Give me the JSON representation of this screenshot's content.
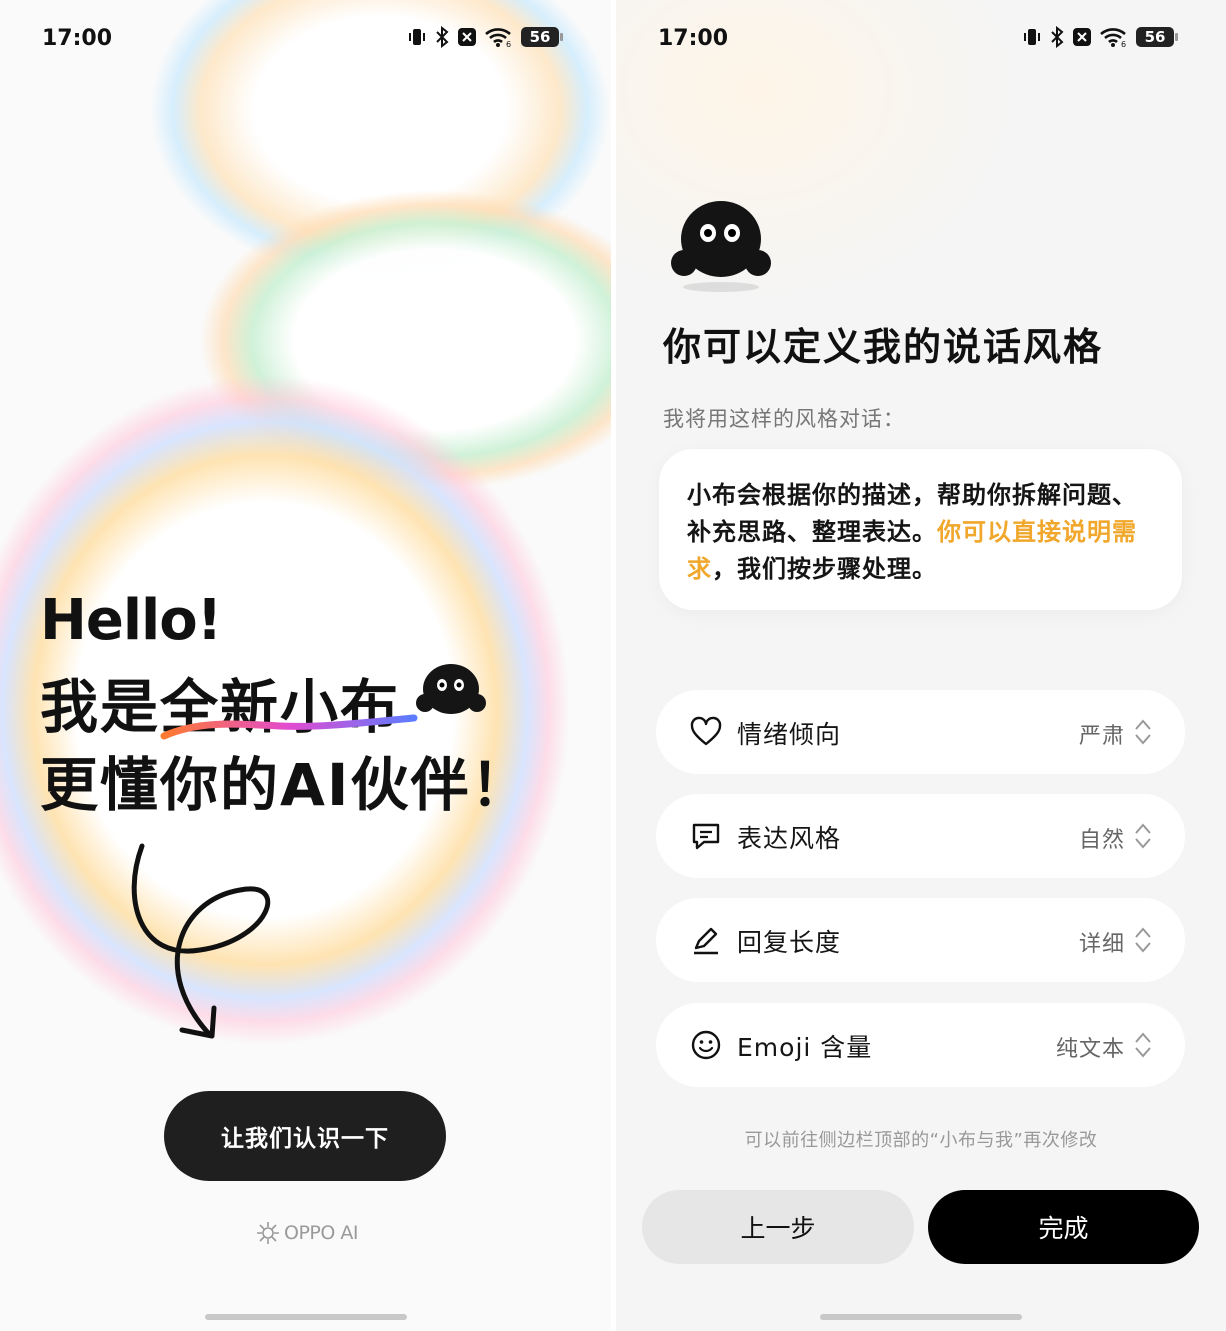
{
  "left": {
    "status": {
      "time": "17:00",
      "battery": "56"
    },
    "greeting": {
      "hello": "Hello!",
      "line1_a": "我是",
      "line1_b": "全新小布",
      "line2": "更懂你的AI伙伴！"
    },
    "intro_button": "让我们认识一下",
    "brand": "OPPO AI"
  },
  "right": {
    "status": {
      "time": "17:00",
      "battery": "56"
    },
    "title": "你可以定义我的说话风格",
    "subtitle": "我将用这样的风格对话：",
    "sample": {
      "text_plain": "小布会根据你的描述，帮助你拆解问题、补充思路、整理表达。",
      "text_highlight": "你可以直接说明需求",
      "text_tail": "，我们按步骤处理。"
    },
    "options": [
      {
        "icon": "heart-icon",
        "label": "情绪倾向",
        "value": "严肃"
      },
      {
        "icon": "chat-bubble-icon",
        "label": "表达风格",
        "value": "自然"
      },
      {
        "icon": "pen-icon",
        "label": "回复长度",
        "value": "详细"
      },
      {
        "icon": "smiley-icon",
        "label": "Emoji 含量",
        "value": "纯文本"
      }
    ],
    "hint": "可以前往侧边栏顶部的“小布与我”再次修改",
    "prev_button": "上一步",
    "done_button": "完成"
  },
  "colors": {
    "highlight": "#f0a72b",
    "primary_button": "#000000",
    "secondary_button": "#e6e6e6"
  }
}
